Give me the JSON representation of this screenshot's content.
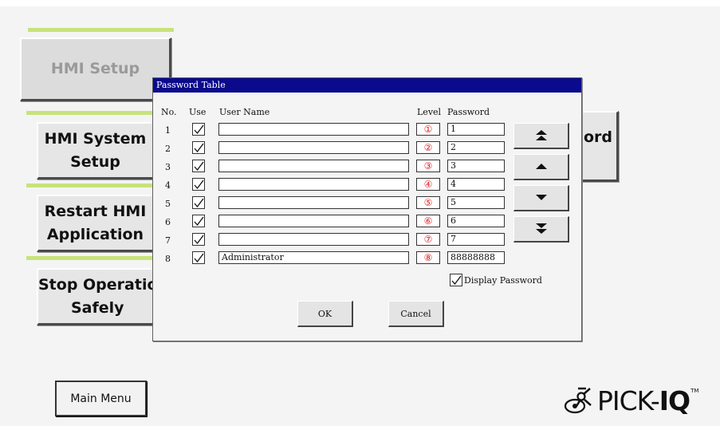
{
  "background": {
    "buttons": [
      {
        "id": "hmi-setup",
        "label": "HMI Setup"
      },
      {
        "id": "hmi-system-setup",
        "label_line1": "HMI System",
        "label_line2": "Setup"
      },
      {
        "id": "restart-hmi",
        "label_line1": "Restart HMI",
        "label_line2": "Application"
      },
      {
        "id": "stop-operation",
        "label_line1": "Stop Operatio",
        "label_line2": "Safely"
      },
      {
        "id": "password",
        "label": "ord"
      }
    ],
    "main_menu_label": "Main Menu",
    "logo": {
      "text": "PICK-",
      "bold": "IQ",
      "tm": "TM"
    }
  },
  "dialog": {
    "title": "Password Table",
    "headers": {
      "no": "No.",
      "use": "Use",
      "user_name": "User Name",
      "level": "Level",
      "password": "Password"
    },
    "rows": [
      {
        "no": "1",
        "use": true,
        "user_name": "",
        "level": "①",
        "password": "1"
      },
      {
        "no": "2",
        "use": true,
        "user_name": "",
        "level": "②",
        "password": "2"
      },
      {
        "no": "3",
        "use": true,
        "user_name": "",
        "level": "③",
        "password": "3"
      },
      {
        "no": "4",
        "use": true,
        "user_name": "",
        "level": "④",
        "password": "4"
      },
      {
        "no": "5",
        "use": true,
        "user_name": "",
        "level": "⑤",
        "password": "5"
      },
      {
        "no": "6",
        "use": true,
        "user_name": "",
        "level": "⑥",
        "password": "6"
      },
      {
        "no": "7",
        "use": true,
        "user_name": "",
        "level": "⑦",
        "password": "7"
      },
      {
        "no": "8",
        "use": true,
        "user_name": "Administrator",
        "level": "⑧",
        "password": "88888888"
      }
    ],
    "display_password": {
      "label": "Display Password",
      "checked": true
    },
    "ok_label": "OK",
    "cancel_label": "Cancel",
    "scroll_buttons": [
      "scroll-top-icon",
      "scroll-up-icon",
      "scroll-down-icon",
      "scroll-bottom-icon"
    ]
  },
  "colors": {
    "title_bar": "#0a0a8c",
    "accent_bar": "#c8e37a",
    "level_text": "#e02020"
  }
}
